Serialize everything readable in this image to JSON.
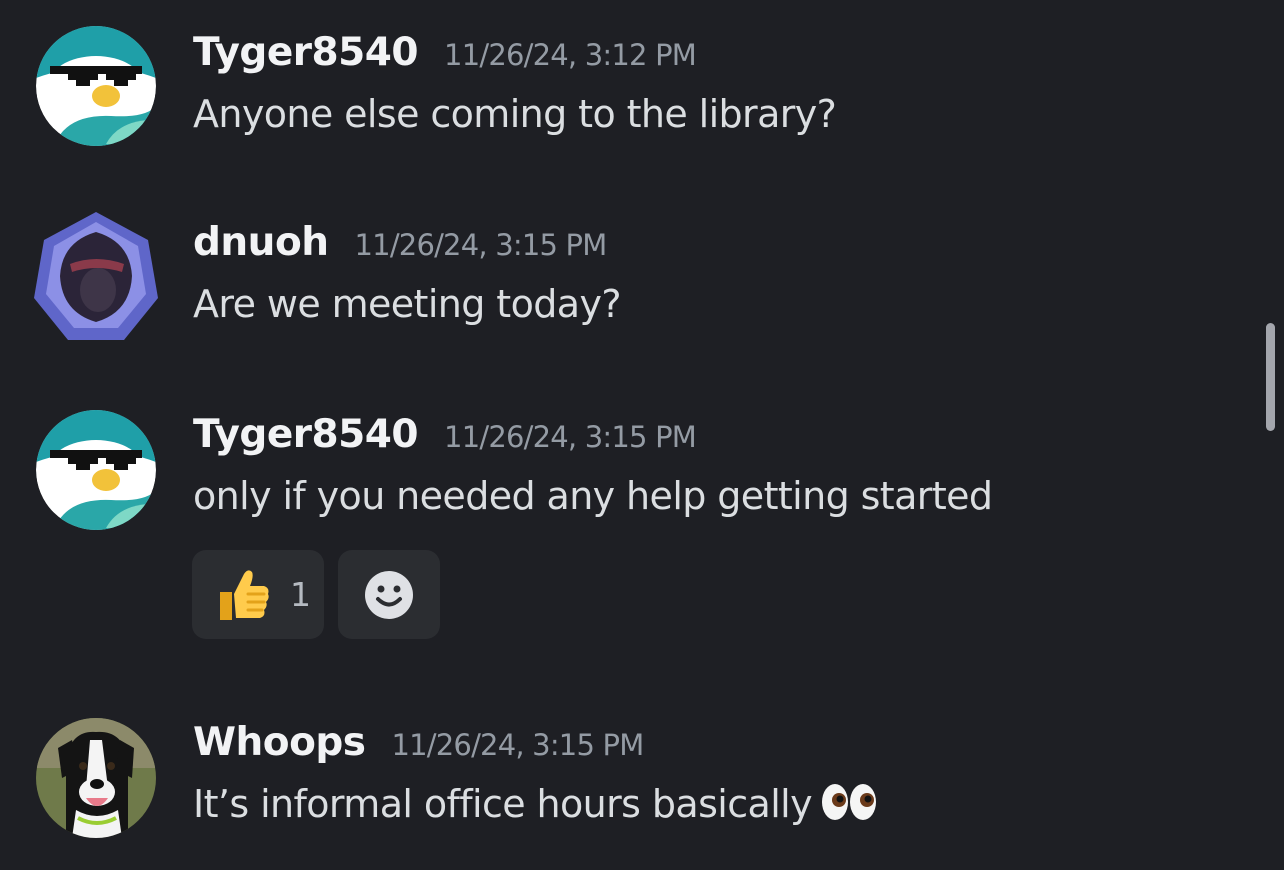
{
  "messages": [
    {
      "username": "Tyger8540",
      "timestamp": "11/26/24, 3:12 PM",
      "text": "Anyone else coming to the library?",
      "avatar": "penguin-sunglasses-avatar"
    },
    {
      "username": "dnuoh",
      "timestamp": "11/26/24, 3:15 PM",
      "text": "Are we meeting today?",
      "avatar": "hooded-figure-avatar"
    },
    {
      "username": "Tyger8540",
      "timestamp": "11/26/24, 3:15 PM",
      "text": "only if you needed any help getting started",
      "avatar": "penguin-sunglasses-avatar",
      "reactions": [
        {
          "emoji": "thumbs-up-icon",
          "count": "1"
        },
        {
          "emoji": "add-reaction-icon",
          "count": ""
        }
      ]
    },
    {
      "username": "Whoops",
      "timestamp": "11/26/24, 3:15 PM",
      "text": "It’s informal office hours basically",
      "trailing_emoji": "eyes-icon",
      "avatar": "dog-avatar"
    }
  ],
  "colors": {
    "background": "#1e1f24",
    "username": "#f2f3f5",
    "timestamp": "#949ba4",
    "message_text": "#dbdee1",
    "reaction_bg": "#2b2d31"
  }
}
